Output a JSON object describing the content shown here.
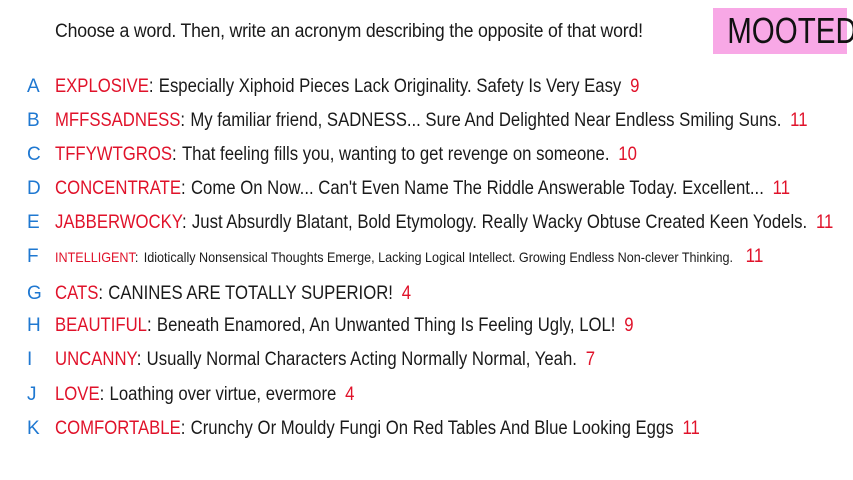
{
  "prompt": "Choose a word. Then, write an acronym describing the opposite of that word!",
  "badge": "MOOTED",
  "colors": {
    "letter": "#1f78d1",
    "word": "#e0122a",
    "score": "#e0122a",
    "badge_bg": "#f8a8e6",
    "text": "#1a1a1a"
  },
  "entries": [
    {
      "letter": "A",
      "word": "EXPLOSIVE",
      "acronym": "Especially Xiphoid Pieces Lack Originality. Safety Is Very Easy",
      "score": "9"
    },
    {
      "letter": "B",
      "word": "MFFSSADNESS",
      "acronym": "My familiar friend, SADNESS... Sure And Delighted Near Endless Smiling Suns.",
      "score": "11"
    },
    {
      "letter": "C",
      "word": "TFFYWTGROS",
      "acronym": "That feeling fills you, wanting to get revenge on someone.",
      "score": "10"
    },
    {
      "letter": "D",
      "word": "CONCENTRATE",
      "acronym": "Come On Now... Can't Even Name The Riddle Answerable Today. Excellent...",
      "score": "11"
    },
    {
      "letter": "E",
      "word": "JABBERWOCKY",
      "acronym": "Just Absurdly Blatant, Bold Etymology. Really Wacky Obtuse Created Keen Yodels.",
      "score": "11"
    },
    {
      "letter": "F",
      "word": "INTELLIGENT",
      "acronym": "Idiotically Nonsensical Thoughts Emerge, Lacking Logical Intellect. Growing Endless Non-clever Thinking.",
      "score": "11"
    },
    {
      "letter": "G",
      "word": "CATS",
      "acronym": "CANINES ARE TOTALLY SUPERIOR!",
      "score": "4"
    },
    {
      "letter": "H",
      "word": "BEAUTIFUL",
      "acronym": "Beneath Enamored, An Unwanted Thing Is Feeling Ugly, LOL!",
      "score": "9"
    },
    {
      "letter": "I",
      "word": "UNCANNY",
      "acronym": "Usually Normal Characters Acting Normally Normal, Yeah.",
      "score": "7"
    },
    {
      "letter": "J",
      "word": "LOVE",
      "acronym": "Loathing over virtue, evermore",
      "score": "4"
    },
    {
      "letter": "K",
      "word": "COMFORTABLE",
      "acronym": "Crunchy Or Mouldy Fungi On Red Tables And Blue Looking Eggs",
      "score": "11"
    }
  ]
}
